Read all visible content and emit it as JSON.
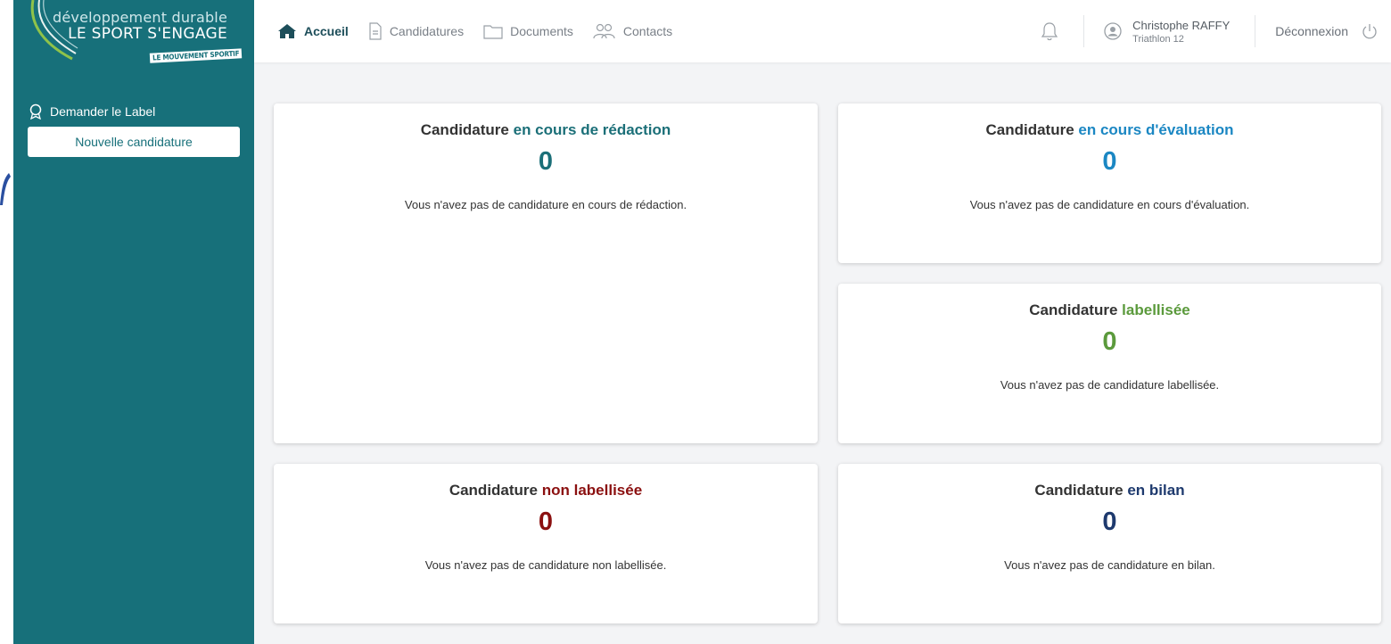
{
  "logo": {
    "line1": "développement durable",
    "line2": "LE SPORT S'ENGAGE",
    "tag": "LE MOUVEMENT SPORTIF"
  },
  "sidebar": {
    "section_label": "Demander le Label",
    "new_button": "Nouvelle candidature"
  },
  "nav": {
    "items": [
      {
        "label": "Accueil",
        "icon": "home-icon"
      },
      {
        "label": "Candidatures",
        "icon": "document-icon"
      },
      {
        "label": "Documents",
        "icon": "folder-icon"
      },
      {
        "label": "Contacts",
        "icon": "contacts-icon"
      }
    ]
  },
  "user": {
    "name": "Christophe RAFFY",
    "organization": "Triathlon 12",
    "logout": "Déconnexion"
  },
  "cards": [
    {
      "prefix": "Candidature",
      "status": "en cours de rédaction",
      "count": "0",
      "message": "Vous n'avez pas de candidature en cours de rédaction.",
      "color": "#1b6f78"
    },
    {
      "prefix": "Candidature",
      "status": "en cours d'évaluation",
      "count": "0",
      "message": "Vous n'avez pas de candidature en cours d'évaluation.",
      "color": "#1b87c3"
    },
    {
      "prefix": "Candidature",
      "status": "labellisée",
      "count": "0",
      "message": "Vous n'avez pas de candidature labellisée.",
      "color": "#5b9a3c"
    },
    {
      "prefix": "Candidature",
      "status": "non labellisée",
      "count": "0",
      "message": "Vous n'avez pas de candidature non labellisée.",
      "color": "#8b1010"
    },
    {
      "prefix": "Candidature",
      "status": "en bilan",
      "count": "0",
      "message": "Vous n'avez pas de candidature en bilan.",
      "color": "#1e3a6e"
    }
  ],
  "colors": {
    "sidebar": "#17707a",
    "background": "#f3f4f6",
    "active_nav": "#1d4e5a"
  }
}
